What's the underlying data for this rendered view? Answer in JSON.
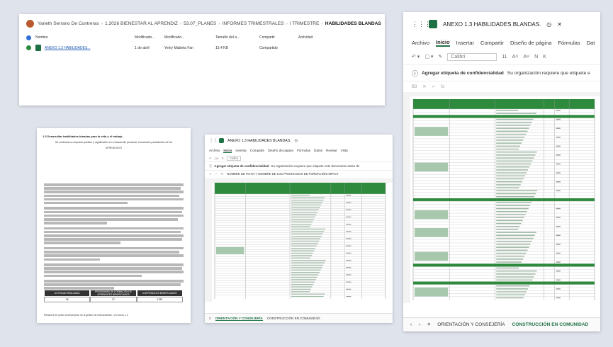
{
  "sharepoint": {
    "owner": "Yaneth Serrano De Contreras",
    "breadcrumb": [
      "1.2026 BIENESTAR AL APRENDIZ",
      "53.07_PLANES",
      "INFORMES TRIMESTRALES",
      "I TRIMESTRE"
    ],
    "current_folder": "HABILIDADES BLANDAS",
    "columns": [
      "Nombre",
      "Modificado...",
      "Modificado...",
      "Tamaño del a...",
      "Compartir",
      "Actividad"
    ],
    "file": {
      "name": "ANEXO 1.3 HABILIDADES...",
      "modified": "1 de abril",
      "modified_by": "Yeiny Mabiela Fan",
      "size": "15,4 KB",
      "sharing": "Compartido"
    }
  },
  "excel_main": {
    "title": "ANEXO 1.3 HABILIDADES BLANDAS.",
    "menu": [
      "Archivo",
      "Inicio",
      "Insertar",
      "Compartir",
      "Diseño de página",
      "Fórmulas",
      "Dat"
    ],
    "active_menu": "Inicio",
    "font_name": "Calibri",
    "font_size": "11",
    "confidentiality_label": "Agregar etiqueta de confidencialidad",
    "confidentiality_text": "Su organización requiere que etiquete e",
    "cell_ref": "B3",
    "tabs": [
      "ORIENTACIÓN Y CONSEJERÍA",
      "CONSTRUCCIÓN EN COMUNIDAD"
    ],
    "active_tab": "CONSTRUCCIÓN EN COMUNIDAD"
  },
  "document": {
    "heading": "1.3 Desarrollar habilidades blandas para la vida y el trabajo.",
    "subtitle": "Se evidencia un impacto positivo y significativo en el desarrollo personal, emocional y académico de los",
    "subtitle2": "APRENDICES",
    "table_headers": [
      "ACTIVIDAD REALIZADA",
      "PROGRAMAS DE FORMACIÓN DE APRENDICES BENEFICIADOS",
      "N APRENDICES BENEFICIADOS"
    ],
    "table_values": [
      "18",
      "27",
      "1789"
    ],
    "footnote": "Relacione en anexo la descripción de la gestión de esta actividad - ver Anexo 1.3"
  },
  "excel_small": {
    "title": "ANEXO 1.3 HABILIDADES BLANDAS.",
    "menu": [
      "Archivo",
      "Inicio",
      "Insertar",
      "Compartir",
      "Diseño de página",
      "Fórmulas",
      "Datos",
      "Revisar",
      "Vista"
    ],
    "active_menu": "Inicio",
    "font_name": "Calibri",
    "confidentiality_label": "Agregar etiqueta de confidencialidad",
    "confidentiality_text": "Su organización requiere que etiquete este documento antes de",
    "formula_text": "NOMBRE DE FICHA Y NOMBRE DE LOS PROGRAMAS DE FORMACIÓN IMPACT",
    "tabs": [
      "ORIENTACIÓN Y CONSEJERÍA",
      "CONSTRUCCIÓN EN COMUNIDAD"
    ],
    "active_tab": "ORIENTACIÓN Y CONSEJERÍA"
  },
  "colors": {
    "excel_green": "#1e7145",
    "header_green": "#2e8b3e",
    "link_blue": "#1a56b0"
  },
  "icons": [
    "user-avatar",
    "star-icon",
    "gear-icon",
    "excel-icon",
    "app-grid-icon",
    "info-icon"
  ]
}
